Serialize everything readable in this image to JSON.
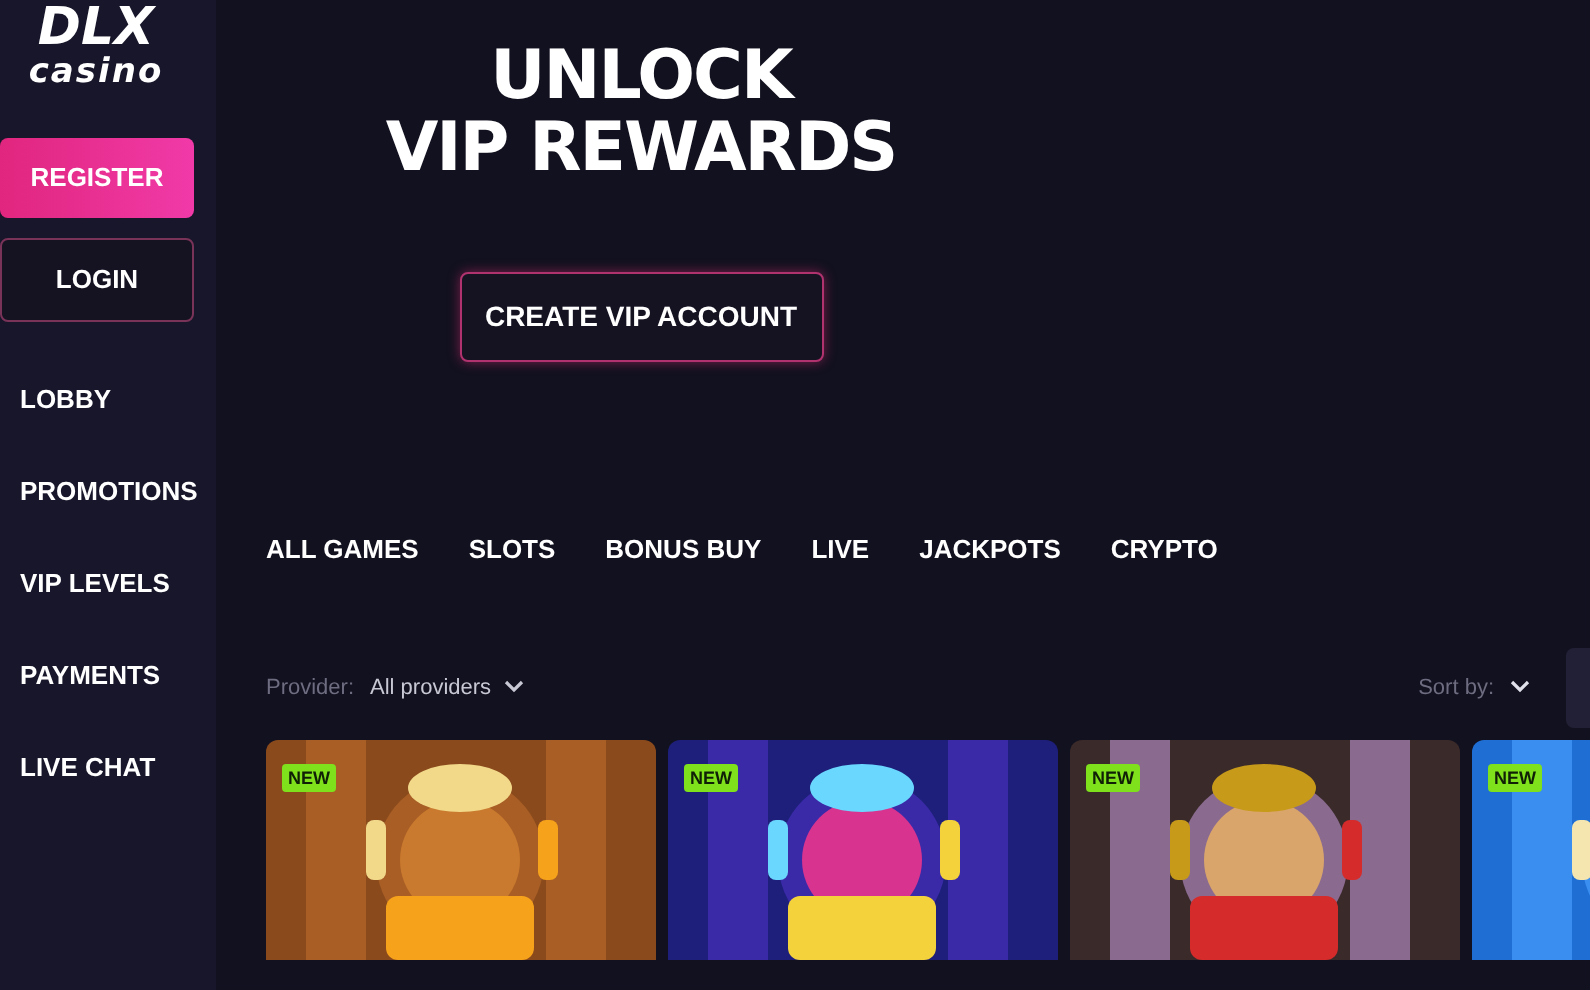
{
  "sidebar": {
    "logo": {
      "title": "DLX",
      "subtitle": "casino"
    },
    "buttons": [
      {
        "label": "REGISTER",
        "kind": "primary"
      },
      {
        "label": "LOGIN",
        "kind": "outline"
      }
    ],
    "items": [
      {
        "label": "LOBBY"
      },
      {
        "label": "PROMOTIONS"
      },
      {
        "label": "VIP LEVELS"
      },
      {
        "label": "PAYMENTS"
      },
      {
        "label": "LIVE CHAT"
      }
    ]
  },
  "hero": {
    "title_lines": [
      "UNLOCK",
      "VIP REWARDS"
    ],
    "button": "CREATE VIP ACCOUNT"
  },
  "tabs": [
    {
      "label": "ALL GAMES"
    },
    {
      "label": "SLOTS"
    },
    {
      "label": "BONUS BUY"
    },
    {
      "label": "LIVE"
    },
    {
      "label": "JACKPOTS"
    },
    {
      "label": "CRYPTO"
    }
  ],
  "filters": {
    "provider_label": "Provider:",
    "provider_value": "All providers",
    "sort_label": "Sort by:"
  },
  "games": [
    {
      "badge": "NEW",
      "kind": "picture"
    },
    {
      "badge": "NEW",
      "kind": "picture"
    },
    {
      "badge": "NEW",
      "kind": "picture"
    },
    {
      "badge": "NEW",
      "kind": "picture"
    }
  ]
}
